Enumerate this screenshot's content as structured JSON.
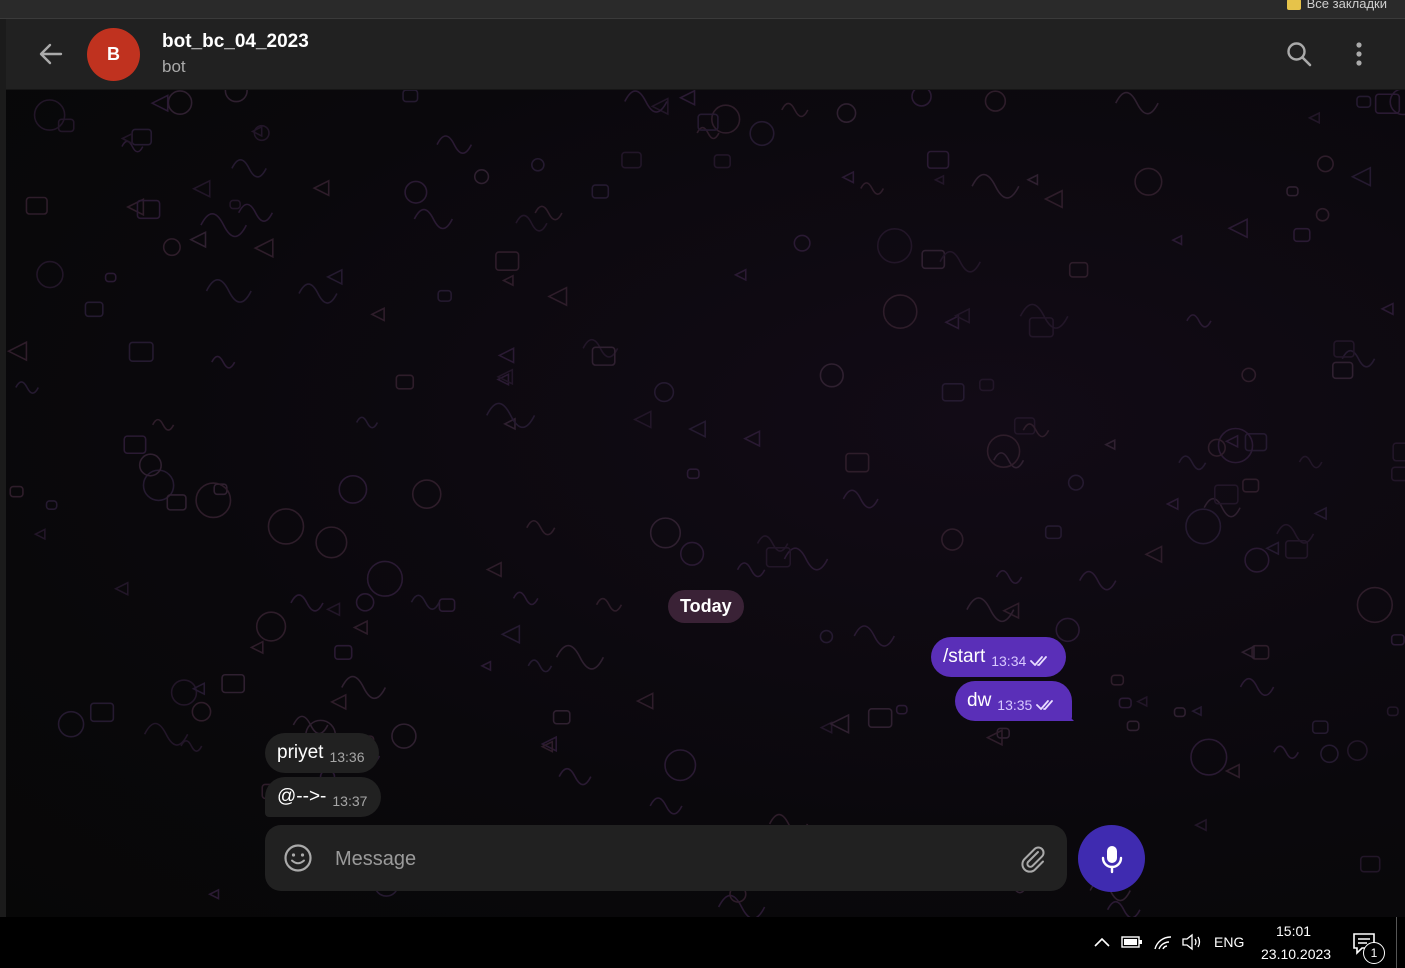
{
  "browser": {
    "bookmark_label": "Все закладки"
  },
  "header": {
    "title": "bot_bc_04_2023",
    "subtitle": "bot",
    "avatar_letter": "B",
    "avatar_color": "#c0321f"
  },
  "chat": {
    "date_separator": "Today",
    "messages": [
      {
        "direction": "out",
        "text": "/start",
        "time": "13:34",
        "status": "read"
      },
      {
        "direction": "out",
        "text": "dw",
        "time": "13:35",
        "status": "read"
      },
      {
        "direction": "in",
        "text": "priyet",
        "time": "13:36"
      },
      {
        "direction": "in",
        "text": "@-->-",
        "time": "13:37"
      }
    ]
  },
  "composer": {
    "placeholder": "Message",
    "value": ""
  },
  "taskbar": {
    "language": "ENG",
    "time": "15:01",
    "date": "23.10.2023",
    "notification_count": "1"
  },
  "colors": {
    "outgoing_bubble": "#5a2fb8",
    "incoming_bubble": "#212121",
    "mic_button": "#3f2bb0",
    "header": "#212121"
  }
}
